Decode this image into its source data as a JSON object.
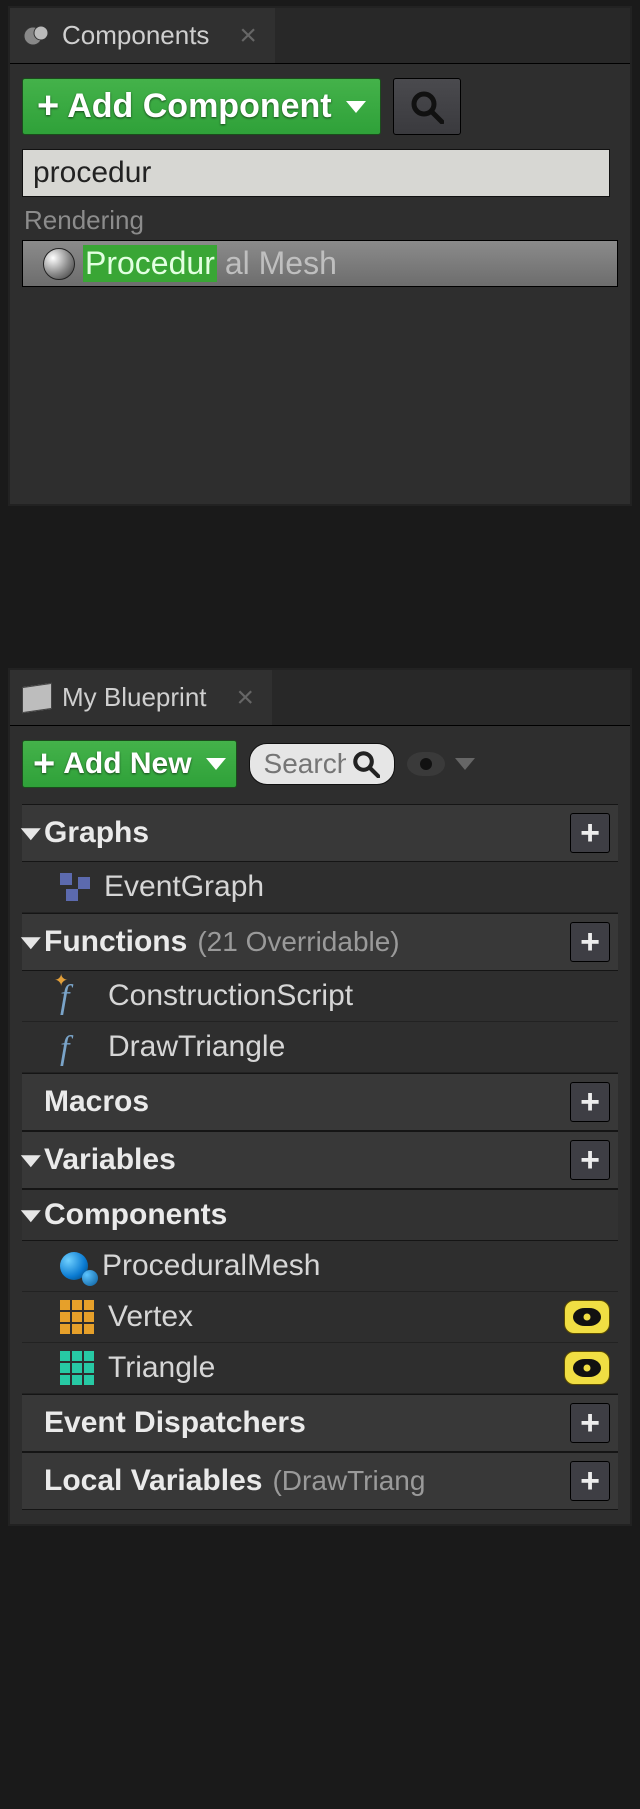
{
  "components_panel": {
    "tab_label": "Components",
    "add_component_label": "Add Component",
    "search_value": "procedur",
    "result_category": "Rendering",
    "result_highlight": "Procedur",
    "result_rest": "al Mesh"
  },
  "blueprint_panel": {
    "tab_label": "My Blueprint",
    "add_new_label": "Add New",
    "search_placeholder": "Search",
    "sections": {
      "graphs": {
        "title": "Graphs"
      },
      "functions": {
        "title": "Functions",
        "subtitle": "(21 Overridable)"
      },
      "macros": {
        "title": "Macros"
      },
      "variables": {
        "title": "Variables"
      },
      "components": {
        "title": "Components"
      },
      "event_dispatchers": {
        "title": "Event Dispatchers"
      },
      "local_variables": {
        "title": "Local Variables",
        "subtitle": "(DrawTriang"
      }
    },
    "items": {
      "event_graph": "EventGraph",
      "construction_script": "ConstructionScript",
      "draw_triangle": "DrawTriangle",
      "procedural_mesh": "ProceduralMesh",
      "vertex": "Vertex",
      "triangle": "Triangle"
    }
  }
}
